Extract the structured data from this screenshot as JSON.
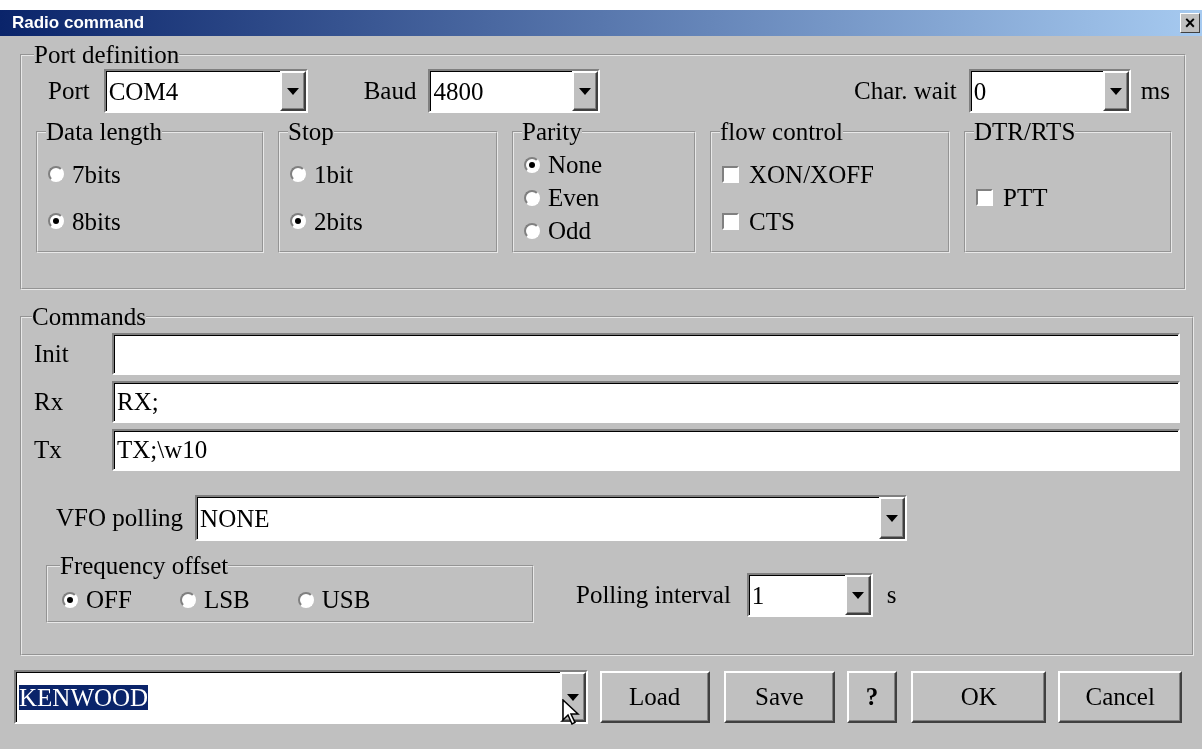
{
  "window": {
    "title": "Radio command",
    "close": "×"
  },
  "port_definition": {
    "title": "Port definition",
    "port": {
      "label": "Port",
      "value": "COM4"
    },
    "baud": {
      "label": "Baud",
      "value": "4800"
    },
    "char_wait": {
      "label": "Char. wait",
      "value": "0",
      "unit": "ms"
    },
    "groups": [
      {
        "title": "Data length",
        "kind": "radio",
        "options": [
          {
            "label": "7bits",
            "selected": false
          },
          {
            "label": "8bits",
            "selected": true
          }
        ]
      },
      {
        "title": "Stop",
        "kind": "radio",
        "options": [
          {
            "label": "1bit",
            "selected": false
          },
          {
            "label": "2bits",
            "selected": true
          }
        ]
      },
      {
        "title": "Parity",
        "kind": "radio",
        "options": [
          {
            "label": "None",
            "selected": true
          },
          {
            "label": "Even",
            "selected": false
          },
          {
            "label": "Odd",
            "selected": false
          }
        ]
      },
      {
        "title": "flow control",
        "kind": "checkbox",
        "options": [
          {
            "label": "XON/XOFF",
            "checked": false
          },
          {
            "label": "CTS",
            "checked": false
          }
        ]
      },
      {
        "title": "DTR/RTS",
        "kind": "checkbox",
        "options": [
          {
            "label": "PTT",
            "checked": false
          }
        ]
      }
    ]
  },
  "commands": {
    "title": "Commands",
    "fields": [
      {
        "label": "Init"
      },
      {
        "label": "Rx",
        "value": "RX;"
      },
      {
        "label": "Tx",
        "value": "TX;\\w10"
      }
    ],
    "vfo_polling": {
      "label": "VFO polling",
      "value": "NONE"
    },
    "frequency_offset": {
      "title": "Frequency offset",
      "options": [
        {
          "label": "OFF",
          "selected": true
        },
        {
          "label": "LSB",
          "selected": false
        },
        {
          "label": "USB",
          "selected": false
        }
      ]
    },
    "polling_interval": {
      "label": "Polling interval",
      "value": "1",
      "unit": "s"
    }
  },
  "profile": {
    "value": "KENWOOD",
    "highlighted": true
  },
  "buttons": [
    {
      "label": "Load"
    },
    {
      "label": "Save"
    },
    {
      "label": "?",
      "bold": true
    },
    {
      "label": "OK"
    },
    {
      "label": "Cancel"
    }
  ]
}
